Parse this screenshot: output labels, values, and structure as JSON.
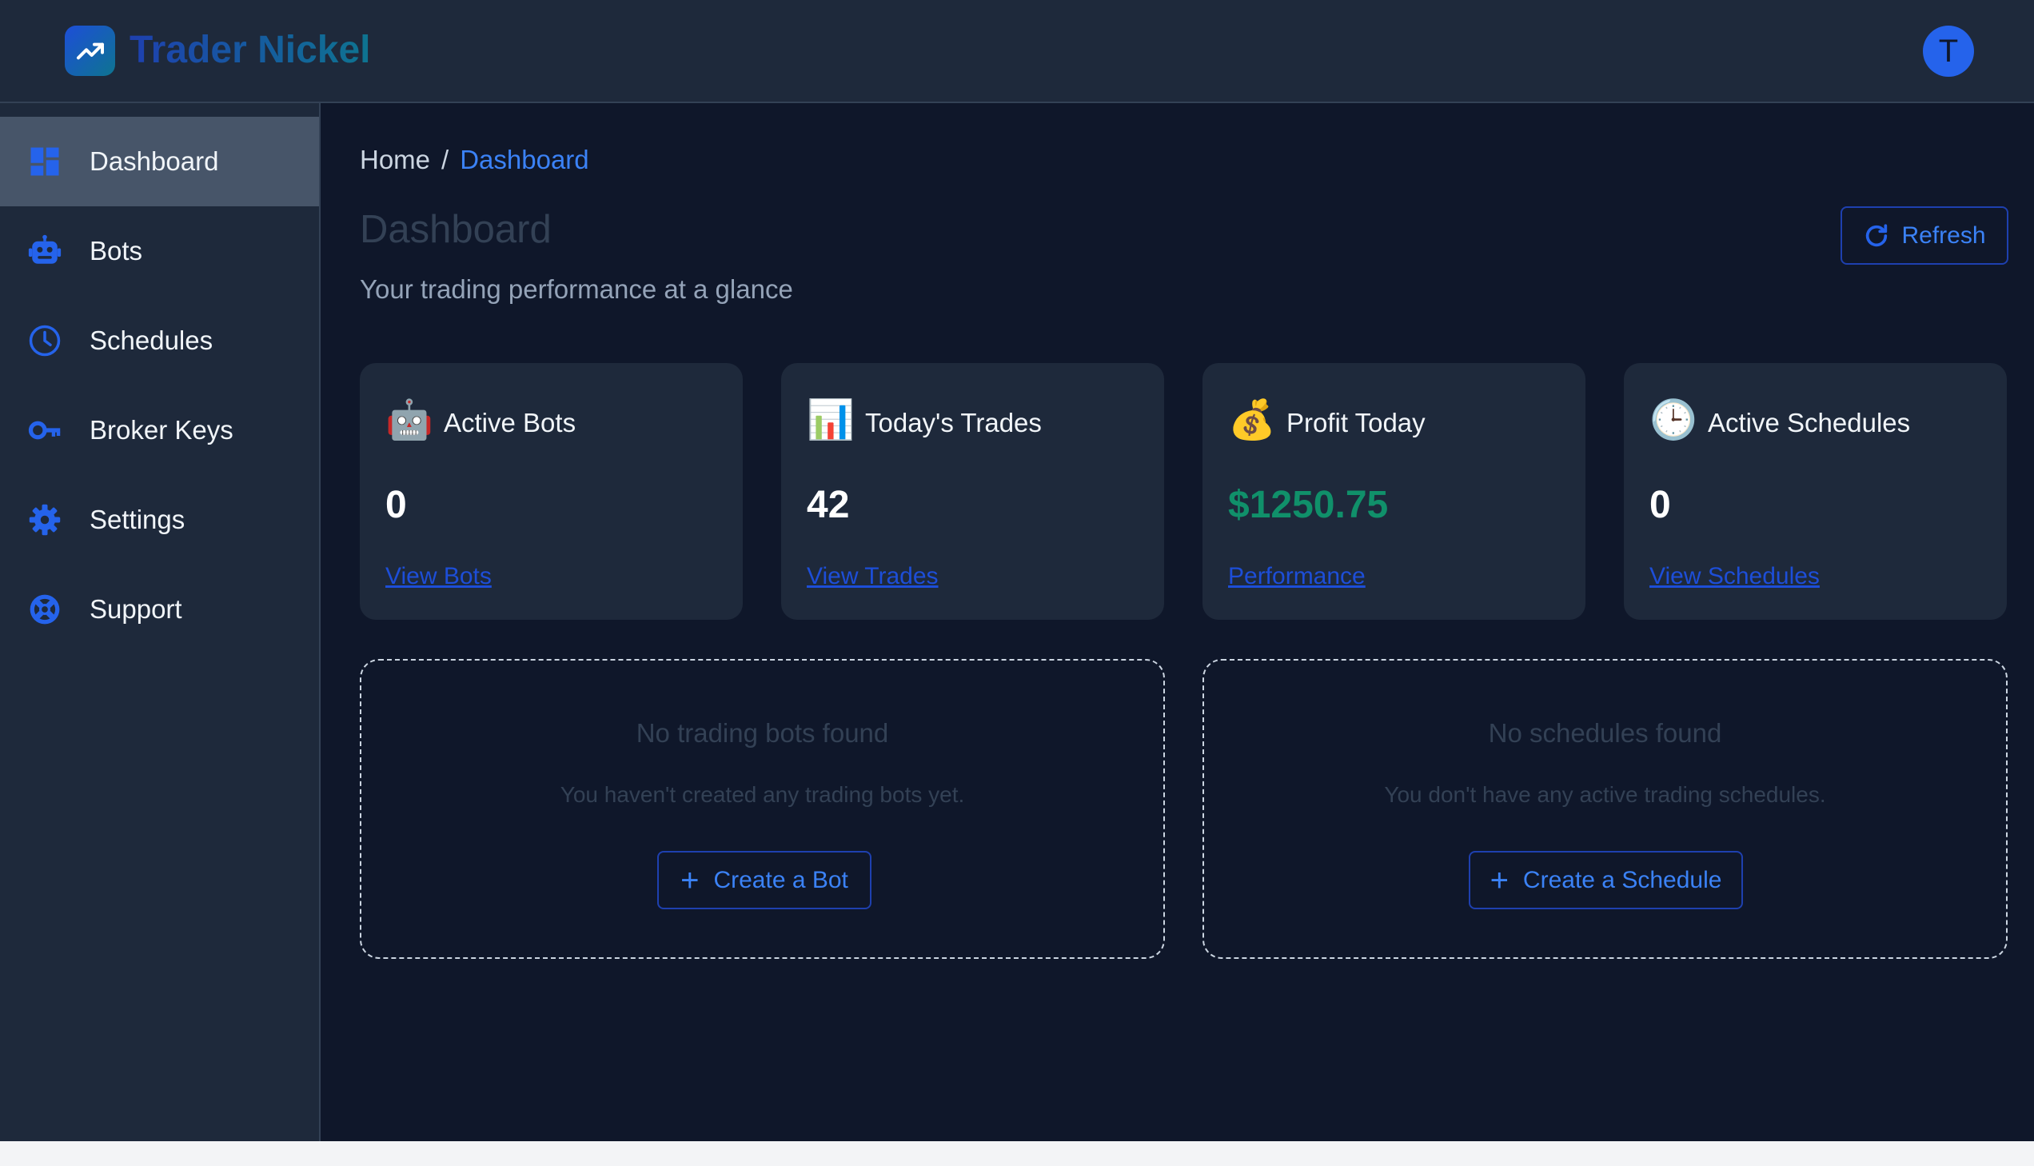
{
  "app": {
    "brand": "Trader Nickel",
    "logo_icon": "trending-up-icon",
    "avatar_initial": "T",
    "colors": {
      "accent": "#3b82f6",
      "avatar": "#2563eb",
      "profit": "#10906a",
      "background": "#0f172a",
      "panel": "#1e293b"
    }
  },
  "sidebar": {
    "items": [
      {
        "label": "Dashboard",
        "icon": "dashboard-icon",
        "active": true
      },
      {
        "label": "Bots",
        "icon": "robot-icon",
        "active": false
      },
      {
        "label": "Schedules",
        "icon": "clock-icon",
        "active": false
      },
      {
        "label": "Broker Keys",
        "icon": "key-icon",
        "active": false
      },
      {
        "label": "Settings",
        "icon": "gear-icon",
        "active": false
      },
      {
        "label": "Support",
        "icon": "lifebuoy-icon",
        "active": false
      }
    ]
  },
  "breadcrumb": {
    "home": "Home",
    "separator": "/",
    "current": "Dashboard"
  },
  "header": {
    "title": "Dashboard",
    "subtitle": "Your trading performance at a glance",
    "refresh_label": "Refresh",
    "refresh_icon": "refresh-icon"
  },
  "stats": [
    {
      "emoji": "🤖",
      "icon": "robot-emoji-icon",
      "title": "Active Bots",
      "value": "0",
      "link": "View Bots"
    },
    {
      "emoji": "📊",
      "icon": "bar-chart-emoji-icon",
      "title": "Today's Trades",
      "value": "42",
      "link": "View Trades"
    },
    {
      "emoji": "💰",
      "icon": "money-bag-emoji-icon",
      "title": "Profit Today",
      "value": "$1250.75",
      "link": "Performance"
    },
    {
      "emoji": "🕒",
      "icon": "clock-emoji-icon",
      "title": "Active Schedules",
      "value": "0",
      "link": "View Schedules"
    }
  ],
  "empty_states": {
    "bots": {
      "title": "No trading bots found",
      "description": "You haven't created any trading bots yet.",
      "button": "Create a Bot"
    },
    "schedules": {
      "title": "No schedules found",
      "description": "You don't have any active trading schedules.",
      "button": "Create a Schedule"
    }
  }
}
